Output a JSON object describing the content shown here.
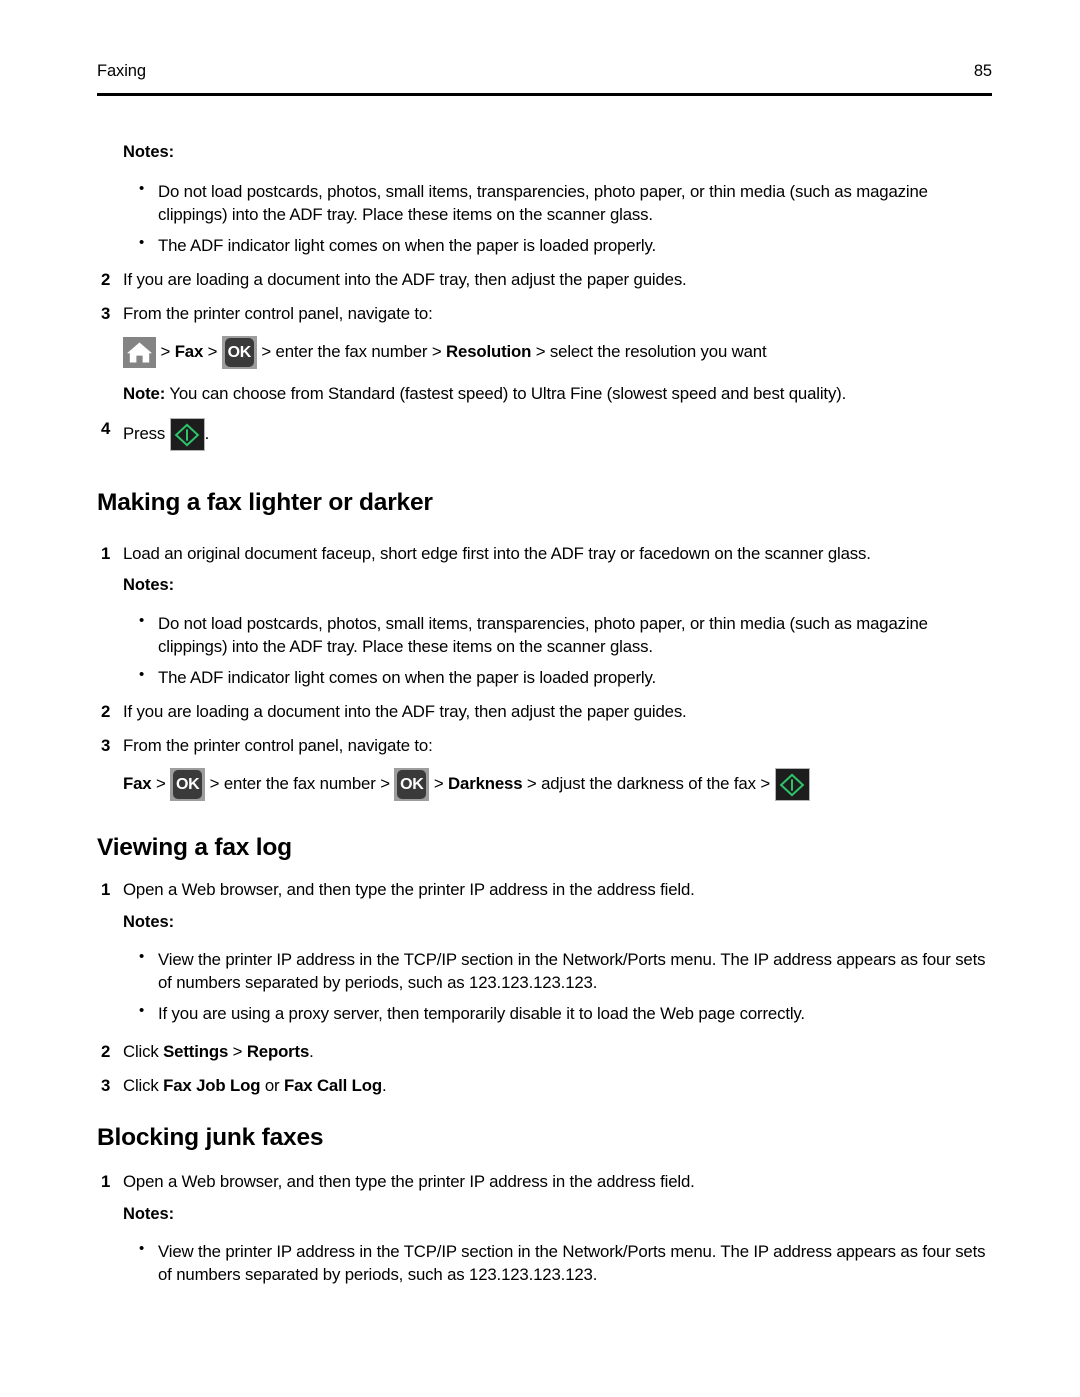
{
  "header": {
    "title": "Faxing",
    "page_number": "85"
  },
  "icons": {
    "home": "home-icon",
    "ok": "OK",
    "start": "start-icon"
  },
  "sections": [
    {
      "id": "resolution-continued",
      "heading": null,
      "notes_label": "Notes:",
      "notes": [
        "Do not load postcards, photos, small items, transparencies, photo paper, or thin media (such as magazine clippings) into the ADF tray. Place these items on the scanner glass.",
        "The ADF indicator light comes on when the paper is loaded properly."
      ],
      "step2_num": "2",
      "step2_text": "If you are loading a document into the ADF tray, then adjust the paper guides.",
      "step3_num": "3",
      "step3_text": "From the printer control panel, navigate to:",
      "nav": {
        "sep1": " > ",
        "fax": "Fax",
        "sep2": " > ",
        "mid": " > enter the fax number > ",
        "resolution": "Resolution",
        "tail": " > select the resolution you want"
      },
      "note_label": "Note:",
      "note_text": " You can choose from Standard (fastest speed) to Ultra Fine (slowest speed and best quality).",
      "step4_num": "4",
      "step4_prefix": "Press ",
      "step4_suffix": "."
    },
    {
      "id": "making-a-fax-lighter-or-darker",
      "heading": "Making a fax lighter or darker",
      "step1_num": "1",
      "step1_text": "Load an original document faceup, short edge first into the ADF tray or facedown on the scanner glass.",
      "notes_label": "Notes:",
      "notes": [
        "Do not load postcards, photos, small items, transparencies, photo paper, or thin media (such as magazine clippings) into the ADF tray. Place these items on the scanner glass.",
        "The ADF indicator light comes on when the paper is loaded properly."
      ],
      "step2_num": "2",
      "step2_text": "If you are loading a document into the ADF tray, then adjust the paper guides.",
      "step3_num": "3",
      "step3_text": "From the printer control panel, navigate to:",
      "nav": {
        "fax": "Fax",
        "sep1": " > ",
        "mid": " > enter the fax number > ",
        "sep2": " > ",
        "darkness": "Darkness",
        "tail": " > adjust the darkness of the fax > "
      }
    },
    {
      "id": "viewing-a-fax-log",
      "heading": "Viewing a fax log",
      "step1_num": "1",
      "step1_text": "Open a Web browser, and then type the printer IP address in the address field.",
      "notes_label": "Notes:",
      "notes": [
        "View the printer IP address in the TCP/IP section in the Network/Ports menu. The IP address appears as four sets of numbers separated by periods, such as 123.123.123.123.",
        "If you are using a proxy server, then temporarily disable it to load the Web page correctly."
      ],
      "step2_num": "2",
      "step2_prefix": "Click ",
      "step2_bold1": "Settings",
      "step2_mid": " > ",
      "step2_bold2": "Reports",
      "step2_suffix": ".",
      "step3_num": "3",
      "step3_prefix": "Click ",
      "step3_bold1": "Fax Job Log",
      "step3_mid": " or ",
      "step3_bold2": "Fax Call Log",
      "step3_suffix": "."
    },
    {
      "id": "blocking-junk-faxes",
      "heading": "Blocking junk faxes",
      "step1_num": "1",
      "step1_text": "Open a Web browser, and then type the printer IP address in the address field.",
      "notes_label": "Notes:",
      "notes": [
        "View the printer IP address in the TCP/IP section in the Network/Ports menu. The IP address appears as four sets of numbers separated by periods, such as 123.123.123.123."
      ]
    }
  ]
}
